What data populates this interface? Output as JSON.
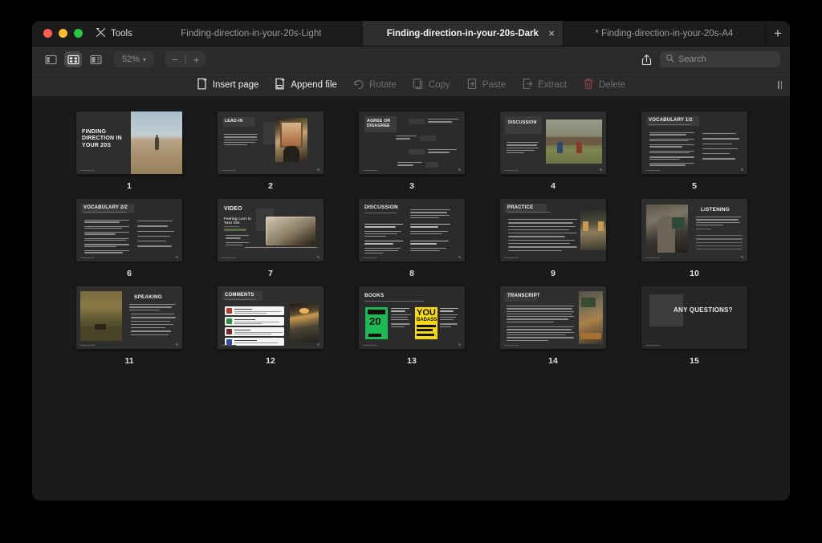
{
  "window": {
    "tools_label": "Tools",
    "tabs": [
      {
        "label": "Finding-direction-in-your-20s-Light",
        "active": false,
        "closable": false
      },
      {
        "label": "Finding-direction-in-your-20s-Dark",
        "active": true,
        "closable": true,
        "close_glyph": "×"
      },
      {
        "label": "* Finding-direction-in-your-20s-A4",
        "active": false,
        "closable": false
      }
    ],
    "new_tab_glyph": "+"
  },
  "toolbar": {
    "view_sidebar_icon": "sidebar-view-icon",
    "view_grid_icon": "grid-view-icon",
    "view_split_icon": "split-view-icon",
    "zoom_level": "52%",
    "zoom_chevron": "⌄",
    "zoom_out": "−",
    "zoom_sep": "|",
    "zoom_in": "+",
    "share_icon": "share-icon",
    "search": {
      "placeholder": "Search",
      "value": "",
      "icon": "search-icon"
    }
  },
  "actions": [
    {
      "label": "Insert page",
      "icon": "insert-page-icon",
      "enabled": true
    },
    {
      "label": "Append file",
      "icon": "append-file-icon",
      "enabled": true
    },
    {
      "label": "Rotate",
      "icon": "rotate-icon",
      "enabled": false
    },
    {
      "label": "Copy",
      "icon": "copy-icon",
      "enabled": false
    },
    {
      "label": "Paste",
      "icon": "paste-icon",
      "enabled": false
    },
    {
      "label": "Extract",
      "icon": "extract-icon",
      "enabled": false
    },
    {
      "label": "Delete",
      "icon": "delete-icon",
      "enabled": false,
      "danger": true
    }
  ],
  "pages": [
    {
      "number": "1",
      "title": "FINDING DIRECTION IN YOUR 20S",
      "layout": "cover-right-photo"
    },
    {
      "number": "2",
      "title": "LEAD-IN",
      "layout": "text-right-photo"
    },
    {
      "number": "3",
      "title": "AGREE OR DISAGREE",
      "layout": "statements"
    },
    {
      "number": "4",
      "title": "DISCUSSION",
      "layout": "text-right-photo-wide"
    },
    {
      "number": "5",
      "title": "VOCABULARY 1/2",
      "layout": "two-column-list"
    },
    {
      "number": "6",
      "title": "VOCABULARY 2/2",
      "layout": "two-column-list"
    },
    {
      "number": "7",
      "title": "VIDEO",
      "layout": "video"
    },
    {
      "number": "8",
      "title": "DISCUSSION",
      "layout": "four-quadrant-text"
    },
    {
      "number": "9",
      "title": "PRACTICE",
      "layout": "numbered-list-photo"
    },
    {
      "number": "10",
      "title": "LISTENING",
      "layout": "left-photo-notes"
    },
    {
      "number": "11",
      "title": "SPEAKING",
      "layout": "left-photo-list"
    },
    {
      "number": "12",
      "title": "COMMENTS",
      "layout": "comment-cards"
    },
    {
      "number": "13",
      "title": "BOOKS",
      "layout": "books"
    },
    {
      "number": "14",
      "title": "TRANSCRIPT",
      "layout": "transcript"
    },
    {
      "number": "15",
      "title": "ANY QUESTIONS?",
      "layout": "closing"
    }
  ],
  "slide_subtitles": {
    "p7_video_title": "Feeling Lost in Your 20s"
  },
  "colors": {
    "window_bg": "#1f1f1f",
    "canvas_bg": "#1a1a1a",
    "toolbar_bg": "#2b2b2b",
    "active_tab_bg": "#2d2d2d",
    "slide_bg": "#2e2e2e",
    "delete_accent": "#c0474a",
    "traffic_red": "#ff5f57",
    "traffic_yellow": "#febc2e",
    "traffic_green": "#28c840",
    "book_green": "#1db954",
    "book_yellow": "#f5d90a"
  }
}
